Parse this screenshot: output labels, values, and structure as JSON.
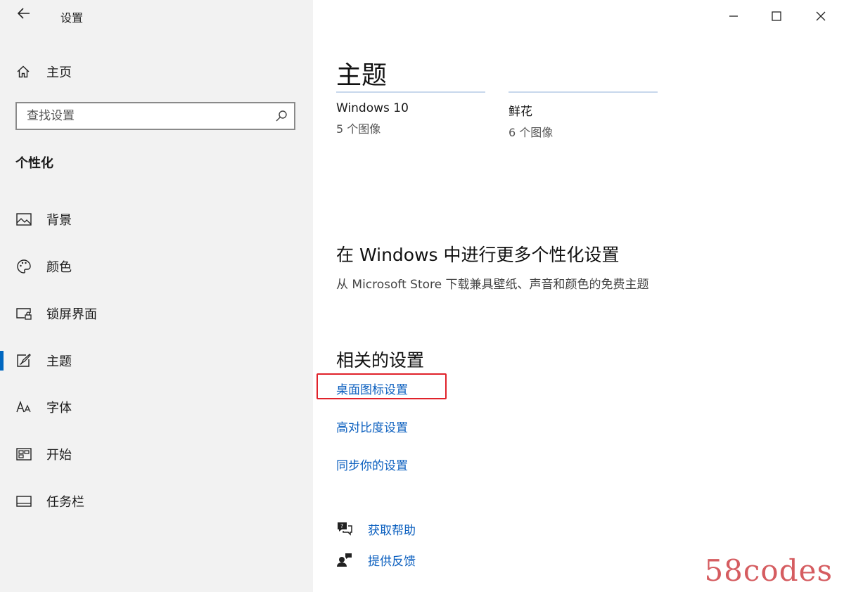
{
  "sidebar": {
    "app_title": "设置",
    "home_label": "主页",
    "search_placeholder": "查找设置",
    "section_title": "个性化",
    "items": [
      {
        "label": "背景",
        "icon": "image-icon"
      },
      {
        "label": "颜色",
        "icon": "palette-icon"
      },
      {
        "label": "锁屏界面",
        "icon": "lock-screen-icon"
      },
      {
        "label": "主题",
        "icon": "theme-brush-icon",
        "selected": true
      },
      {
        "label": "字体",
        "icon": "font-icon"
      },
      {
        "label": "开始",
        "icon": "start-icon"
      },
      {
        "label": "任务栏",
        "icon": "taskbar-icon"
      }
    ]
  },
  "main": {
    "title": "主题",
    "themes": [
      {
        "name": "Windows 10",
        "count": "5 个图像"
      },
      {
        "name": "鲜花",
        "count": "6 个图像"
      }
    ],
    "more_title": "在 Windows 中进行更多个性化设置",
    "more_desc": "从 Microsoft Store 下载兼具壁纸、声音和颜色的免费主题",
    "related_title": "相关的设置",
    "related_links": [
      "桌面图标设置",
      "高对比度设置",
      "同步你的设置"
    ],
    "help": [
      {
        "label": "获取帮助",
        "icon": "chat-help-icon"
      },
      {
        "label": "提供反馈",
        "icon": "feedback-icon"
      }
    ]
  },
  "watermark": "58codes",
  "colors": {
    "accent": "#0067c0",
    "link": "#0b5fbf",
    "highlight": "#e0222a",
    "sidebar_bg": "#f2f2f2"
  }
}
